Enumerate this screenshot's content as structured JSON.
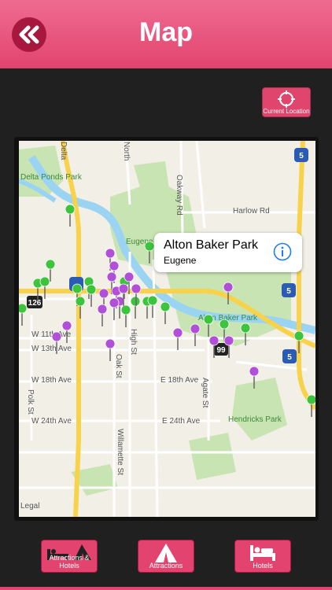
{
  "header": {
    "title": "Map"
  },
  "current_location": {
    "label": "Current Location"
  },
  "callout": {
    "title": "Alton Baker Park",
    "subtitle": "Eugene"
  },
  "map_labels": {
    "delta_ponds": "Delta Ponds Park",
    "harlow": "Harlow Rd",
    "oakway": "Oakway Rd",
    "eugene_country": "Eugene Country",
    "alton_park": "Alton Baker Park",
    "w11": "W 11th Ave",
    "w13": "W 13th Ave",
    "w18": "W 18th Ave",
    "e18": "E 18th Ave",
    "w24": "W 24th Ave",
    "e24": "E 24th Ave",
    "hendricks": "Hendricks Park",
    "polk": "Polk St",
    "oak": "Oak St",
    "high": "High St",
    "agate": "Agate St",
    "willamette": "Willamette St",
    "legal": "Legal",
    "hwy126": "126",
    "i5a": "5",
    "i5b": "5",
    "i5c": "5",
    "hwy99": "99",
    "north": "North",
    "delta": "Delta"
  },
  "tabs": {
    "attractions_hotels": "Attractions & Hotels",
    "attractions": "Attractions",
    "hotels": "Hotels"
  },
  "colors": {
    "accent": "#e2446f",
    "pin_green": "#3cc43c",
    "pin_purple": "#b24fd8",
    "river": "#9ad4f2"
  }
}
